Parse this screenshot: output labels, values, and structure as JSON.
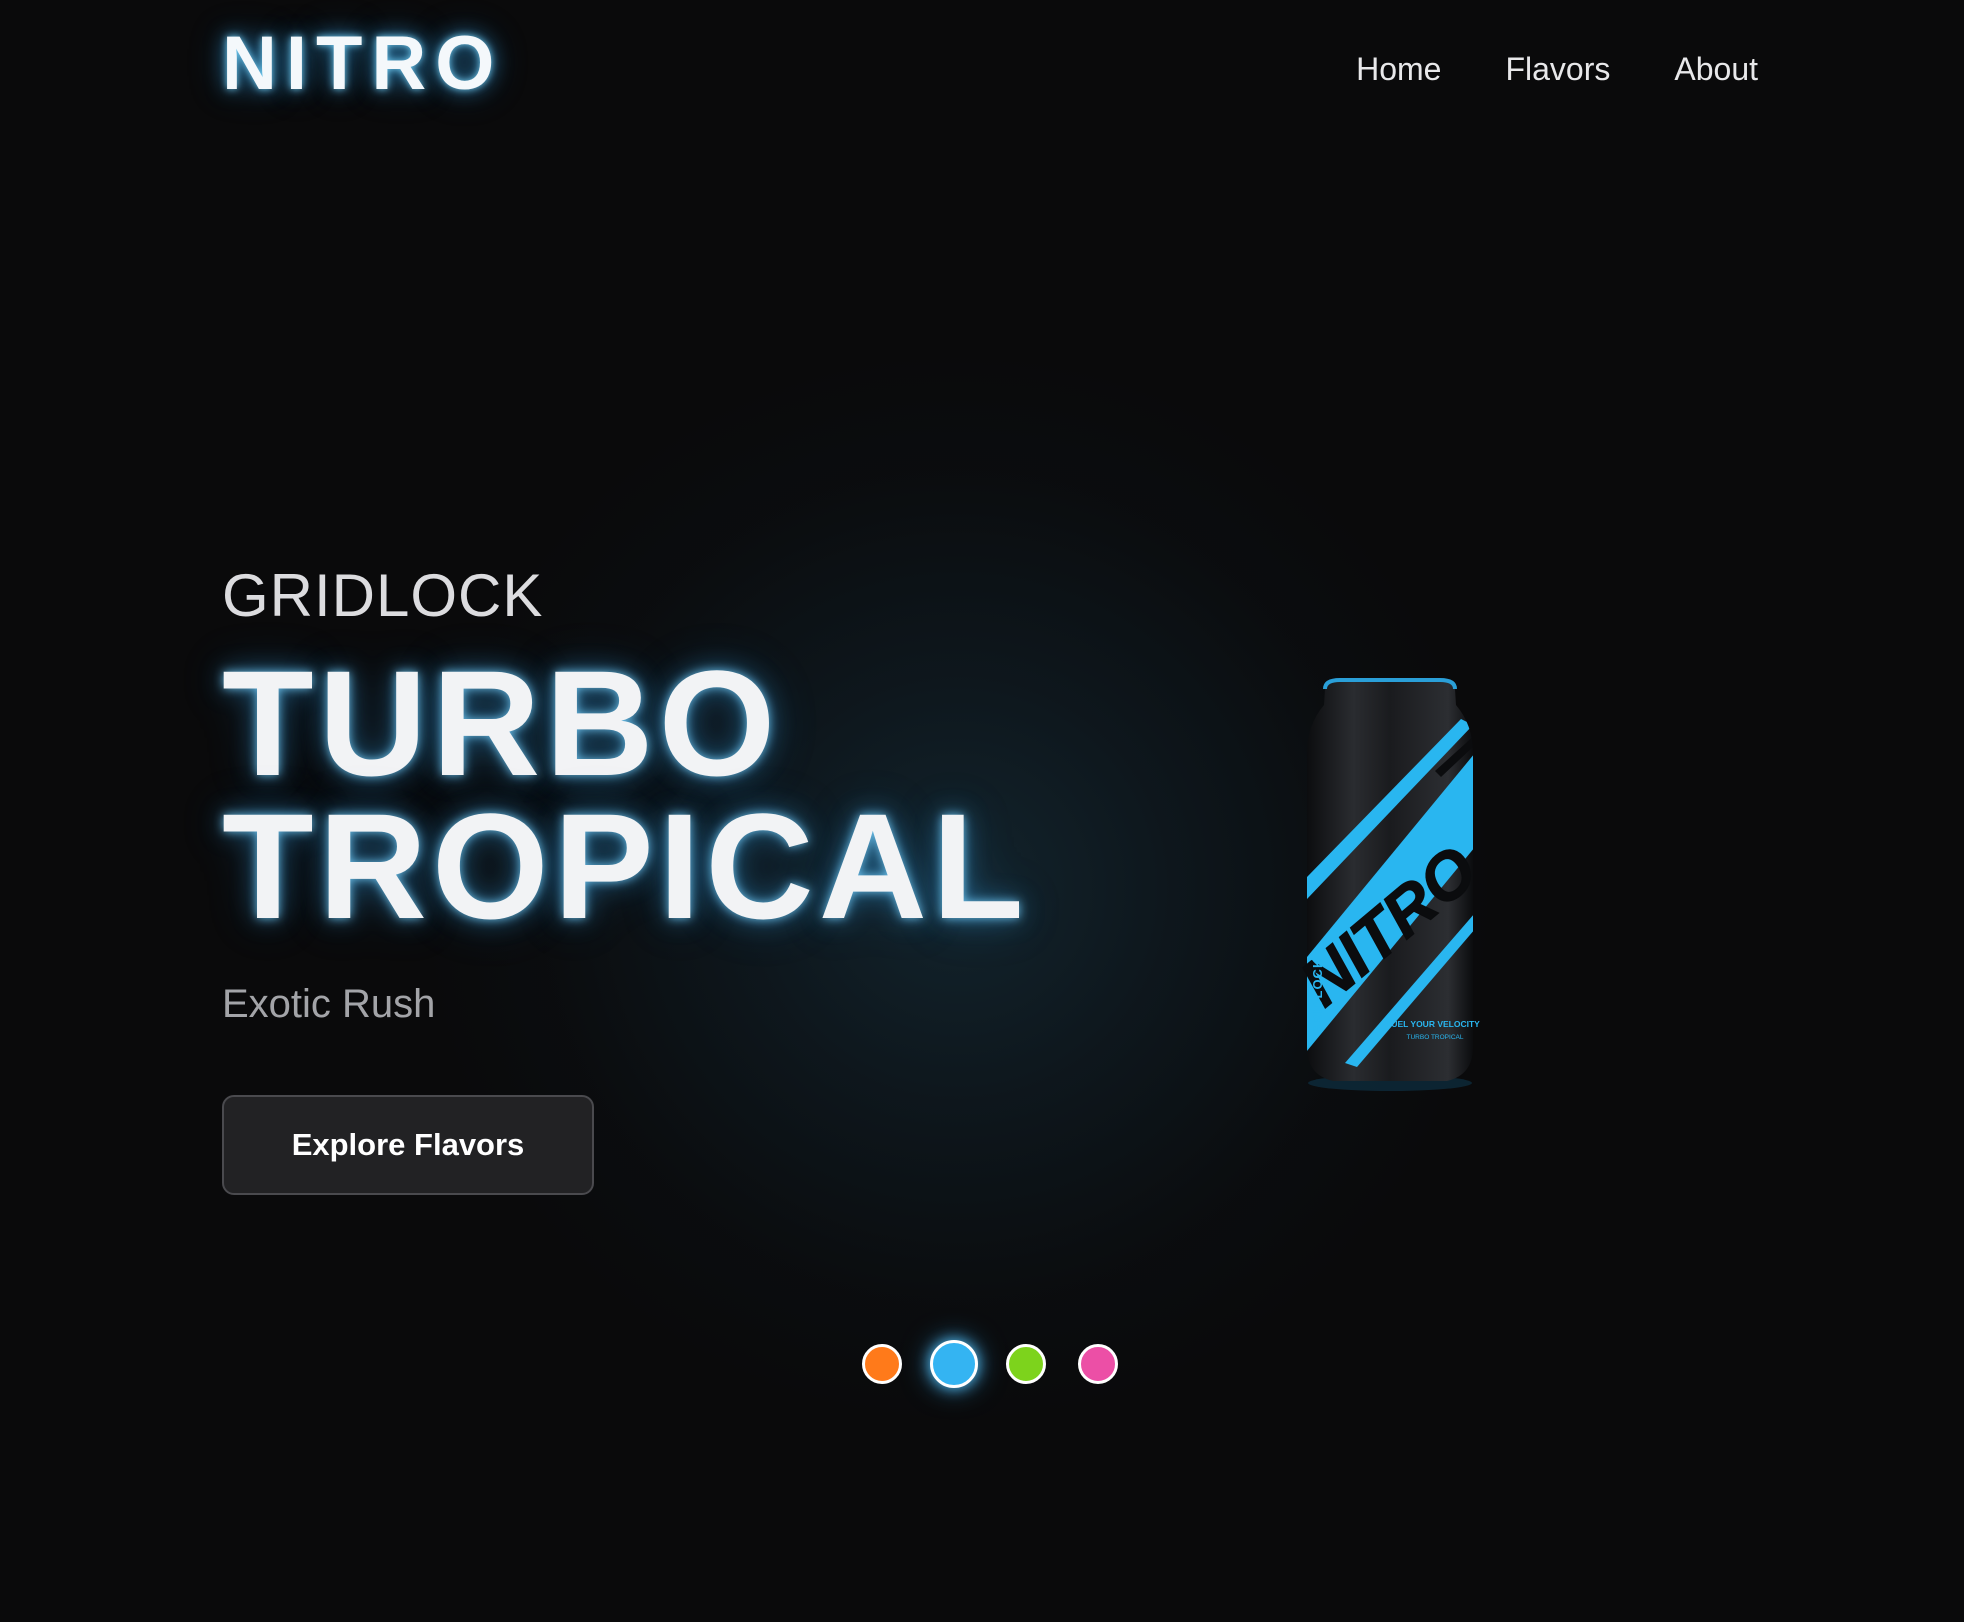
{
  "header": {
    "logo": "NITRO",
    "nav": [
      "Home",
      "Flavors",
      "About"
    ]
  },
  "hero": {
    "subtitle": "GRIDLOCK",
    "title_lines": [
      "TURBO",
      "TROPICAL"
    ],
    "tagline": "Exotic Rush",
    "cta_label": "Explore Flavors"
  },
  "can": {
    "brand": "NITRO",
    "side_text": "GRIDLOCK",
    "slogan": "FUEL YOUR VELOCITY",
    "flavor": "TURBO TROPICAL",
    "accent_color": "#29b6f0"
  },
  "carousel": {
    "active_index": 1,
    "dots": [
      {
        "color": "#ff7a1a"
      },
      {
        "color": "#34b4f2"
      },
      {
        "color": "#7dd31c"
      },
      {
        "color": "#ec4fa6"
      }
    ]
  }
}
